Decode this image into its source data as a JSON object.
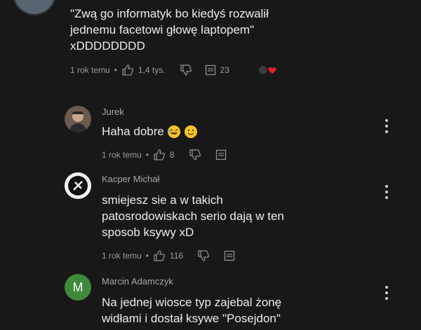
{
  "top_comment": {
    "text_line1": "\"Zwą go informatyk bo kiedyś rozwalił",
    "text_line2": "jednemu facetowi głowę laptopem\"",
    "text_line3": "xDDDDDDDD",
    "time": "1 rok temu",
    "likes": "1,4 tys.",
    "replies": "23"
  },
  "replies": [
    {
      "author": "Jurek",
      "text_line1": "Haha dobre",
      "time": "1 rok temu",
      "likes": "8"
    },
    {
      "author": "Kacper Michał",
      "text_line1": "smiejesz sie a w takich",
      "text_line2": "patosrodowiskach serio dają w ten",
      "text_line3": "sposob ksywy xD",
      "time": "1 rok temu",
      "likes": "116"
    },
    {
      "author": "Marcin Adamczyk",
      "avatar_letter": "M",
      "text_line1": "Na jednej wiosce typ zajebal żonę",
      "text_line2": "widłami i dostał ksywe \"Posejdon\""
    }
  ],
  "colors": {
    "background": "#181818",
    "text": "#ececec",
    "muted": "#9a9a9a",
    "avatar_green": "#3f8a3a",
    "heart": "#e0202a"
  }
}
